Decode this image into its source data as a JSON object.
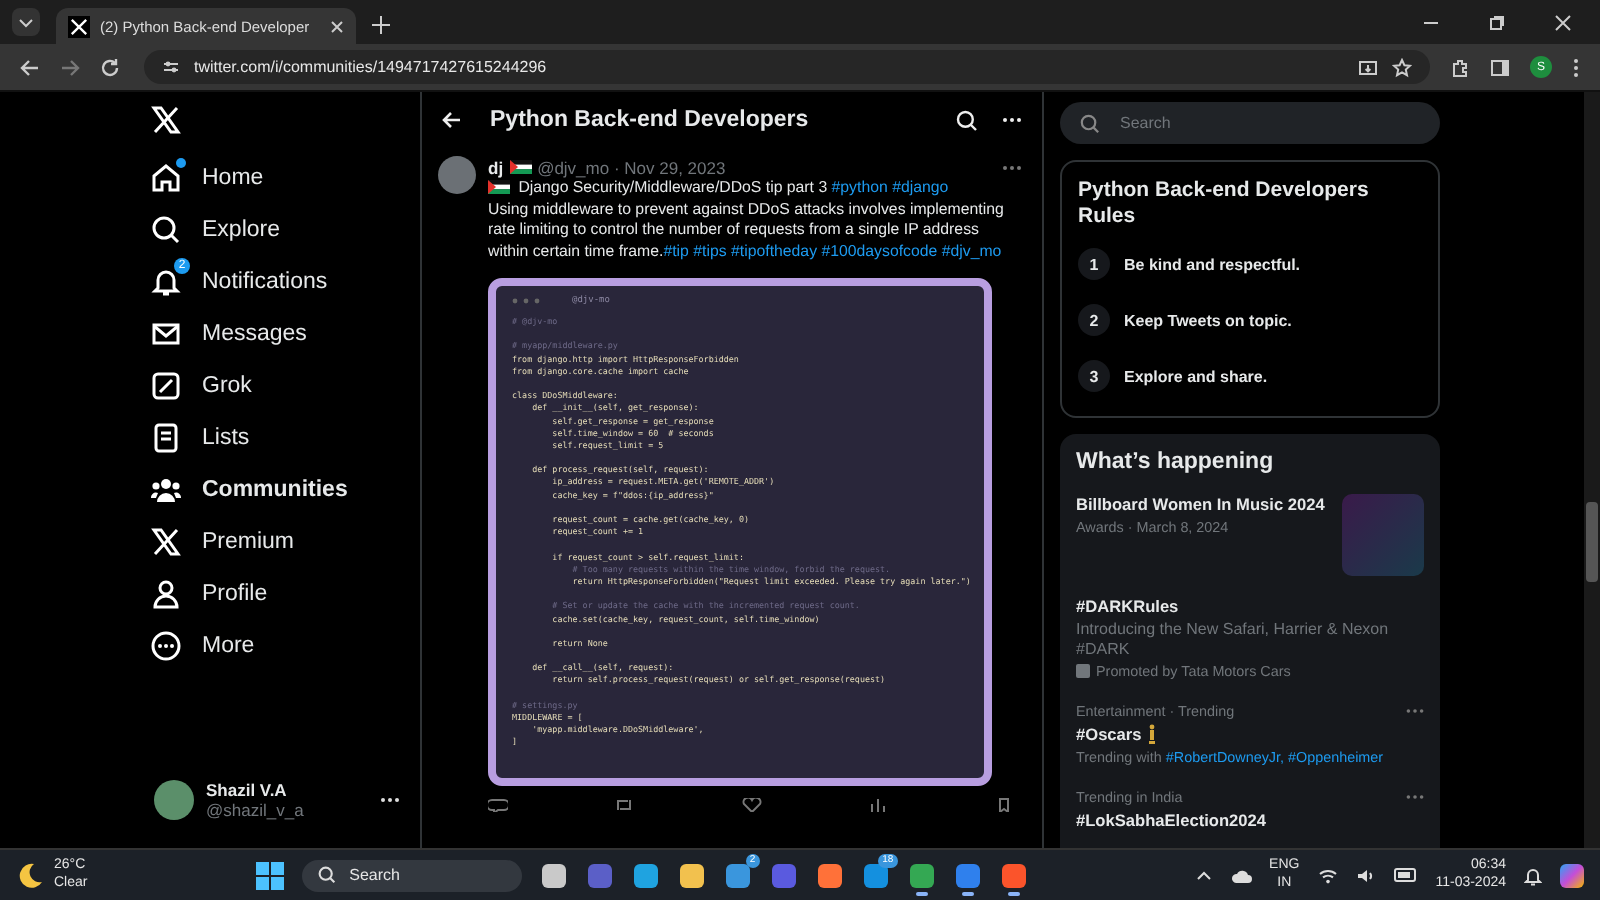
{
  "browser": {
    "tab_title": "(2) Python Back-end Developer",
    "url": "twitter.com/i/communities/1494717427615244296",
    "profile_initial": "S"
  },
  "nav": {
    "items": [
      {
        "label": "Home",
        "selected": false,
        "dot": true
      },
      {
        "label": "Explore",
        "selected": false,
        "dot": false
      },
      {
        "label": "Notifications",
        "selected": false,
        "dot": false,
        "badge": "2"
      },
      {
        "label": "Messages",
        "selected": false,
        "dot": false
      },
      {
        "label": "Grok",
        "selected": false,
        "dot": false
      },
      {
        "label": "Lists",
        "selected": false,
        "dot": false
      },
      {
        "label": "Communities",
        "selected": true,
        "dot": false
      },
      {
        "label": "Premium",
        "selected": false,
        "dot": false
      },
      {
        "label": "Profile",
        "selected": false,
        "dot": false
      },
      {
        "label": "More",
        "selected": false,
        "dot": false
      }
    ],
    "account": {
      "name": "Shazil V.A",
      "handle": "@shazil_v_a"
    }
  },
  "header": {
    "title": "Python Back-end Developers"
  },
  "tweet": {
    "name": "dj",
    "meta": "@djv_mo · Nov 29, 2023",
    "paragraphs": [
      [
        {
          "text": "Django Security/Middleware/DDoS tip part 3 ",
          "kind": "text"
        },
        {
          "text": "#python",
          "kind": "tag"
        },
        {
          "text": "#django",
          "kind": "tag"
        }
      ],
      [
        {
          "text": "Using middleware to prevent against DDoS attacks involves implementing rate limiting to control the number of requests from a single IP address within certain time frame.",
          "kind": "text"
        },
        {
          "text": "#tip",
          "kind": "tag"
        },
        {
          "text": "#tips",
          "kind": "tag"
        },
        {
          "text": "#tipoftheday",
          "kind": "tag"
        },
        {
          "text": "#100daysofcode",
          "kind": "tag"
        },
        {
          "text": "#djv_mo",
          "kind": "tag"
        }
      ]
    ],
    "code": {
      "title": "@djv-mo",
      "lines": [
        {
          "kind": "comment",
          "text": "# @djv-mo"
        },
        {
          "kind": "blank"
        },
        {
          "kind": "comment",
          "text": "# myapp/middleware.py"
        },
        {
          "kind": "code",
          "text": "from django.http import HttpResponseForbidden"
        },
        {
          "kind": "code",
          "text": "from django.core.cache import cache"
        },
        {
          "kind": "blank"
        },
        {
          "kind": "code",
          "text": "class DDoSMiddleware:"
        },
        {
          "kind": "code",
          "text": "    def __init__(self, get_response):"
        },
        {
          "kind": "code",
          "text": "        self.get_response = get_response"
        },
        {
          "kind": "code",
          "text": "        self.time_window = 60  # seconds"
        },
        {
          "kind": "code",
          "text": "        self.request_limit = 5"
        },
        {
          "kind": "blank"
        },
        {
          "kind": "code",
          "text": "    def process_request(self, request):"
        },
        {
          "kind": "code",
          "text": "        ip_address = request.META.get('REMOTE_ADDR')"
        },
        {
          "kind": "code",
          "text": "        cache_key = f\"ddos:{ip_address}\""
        },
        {
          "kind": "blank"
        },
        {
          "kind": "code",
          "text": "        request_count = cache.get(cache_key, 0)"
        },
        {
          "kind": "code",
          "text": "        request_count += 1"
        },
        {
          "kind": "blank"
        },
        {
          "kind": "code",
          "text": "        if request_count > self.request_limit:"
        },
        {
          "kind": "comment",
          "text": "            # Too many requests within the time window, forbid the request."
        },
        {
          "kind": "code",
          "text": "            return HttpResponseForbidden(\"Request limit exceeded. Please try again later.\")"
        },
        {
          "kind": "blank"
        },
        {
          "kind": "comment",
          "text": "        # Set or update the cache with the incremented request count."
        },
        {
          "kind": "code",
          "text": "        cache.set(cache_key, request_count, self.time_window)"
        },
        {
          "kind": "blank"
        },
        {
          "kind": "code",
          "text": "        return None"
        },
        {
          "kind": "blank"
        },
        {
          "kind": "code",
          "text": "    def __call__(self, request):"
        },
        {
          "kind": "code",
          "text": "        return self.process_request(request) or self.get_response(request)"
        },
        {
          "kind": "blank"
        },
        {
          "kind": "comment",
          "text": "# settings.py"
        },
        {
          "kind": "code",
          "text": "MIDDLEWARE = ["
        },
        {
          "kind": "code",
          "text": "    'myapp.middleware.DDoSMiddleware',"
        },
        {
          "kind": "code",
          "text": "]"
        }
      ]
    }
  },
  "search": {
    "placeholder": "Search"
  },
  "rules": {
    "title": "Python Back-end Developers Rules",
    "items": [
      {
        "number": "1",
        "text": "Be kind and respectful."
      },
      {
        "number": "2",
        "text": "Keep Tweets on topic."
      },
      {
        "number": "3",
        "text": "Explore and share."
      }
    ]
  },
  "happening": {
    "title": "What’s happening",
    "items": [
      {
        "kind": "event",
        "title": "Billboard Women In Music 2024",
        "meta": "Awards · March 8, 2024"
      },
      {
        "kind": "promoted",
        "title": "#DARKRules",
        "description": "Introducing the New Safari, Harrier & Nexon #DARK",
        "promoter": "Promoted by Tata Motors Cars"
      },
      {
        "kind": "trend",
        "context": "Entertainment · Trending",
        "title": "#Oscars",
        "award_icon": true,
        "with_label": "Trending with",
        "tags": [
          "#RobertDowneyJr,",
          "#Oppenheimer"
        ]
      },
      {
        "kind": "trend",
        "context": "Trending in India",
        "title": "#LokSabhaElection2024",
        "award_icon": false
      }
    ]
  },
  "taskbar": {
    "weather": {
      "temp": "26°C",
      "condition": "Clear"
    },
    "search": "Search",
    "apps": [
      {
        "kind": "taskview",
        "running": false
      },
      {
        "kind": "teams",
        "running": false
      },
      {
        "kind": "edge",
        "running": false
      },
      {
        "kind": "folder",
        "running": false
      },
      {
        "kind": "store",
        "running": false,
        "badge": "2"
      },
      {
        "kind": "editor",
        "running": false
      },
      {
        "kind": "firefox",
        "running": false
      },
      {
        "kind": "outlook",
        "running": false,
        "badge": "18"
      },
      {
        "kind": "chrome",
        "running": true
      },
      {
        "kind": "vscode",
        "running": true
      },
      {
        "kind": "brave",
        "running": true
      }
    ],
    "lang": [
      "ENG",
      "IN"
    ],
    "time": "06:34",
    "date": "11-03-2024"
  }
}
